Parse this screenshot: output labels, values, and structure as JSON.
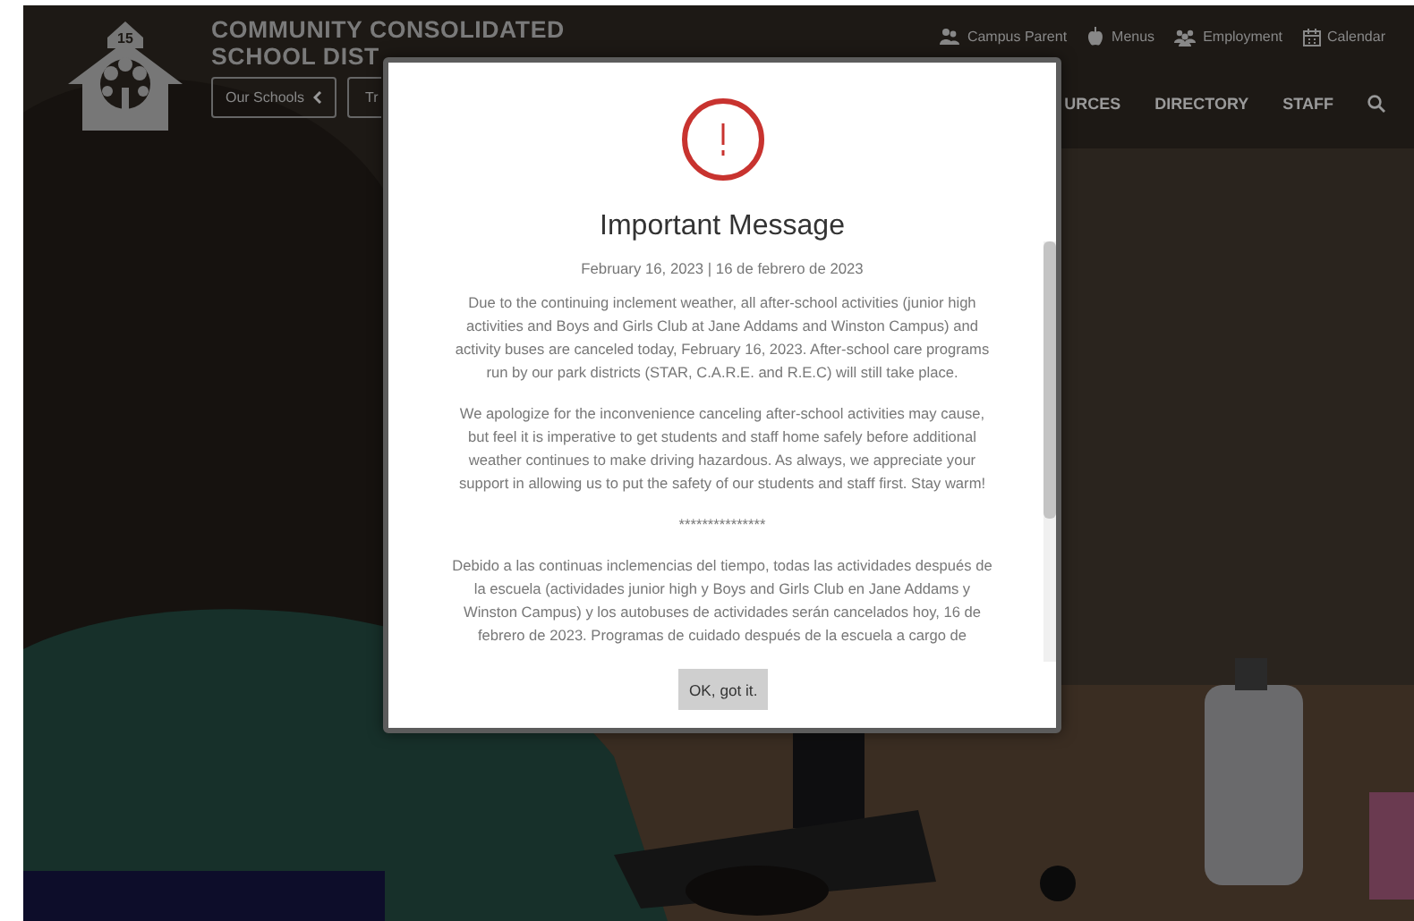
{
  "header": {
    "logo_badge": "15",
    "title_lines": [
      "COMMUNITY CONSOLIDATED",
      "SCHOOL DIST"
    ],
    "buttons": [
      {
        "label": "Our Schools",
        "kind": "dropdown"
      },
      {
        "label": "Tr",
        "kind": "plain"
      }
    ],
    "quick_links": [
      {
        "label": "Campus Parent",
        "kind": "parent"
      },
      {
        "label": "Menus",
        "kind": "menus"
      },
      {
        "label": "Employment",
        "kind": "employment"
      },
      {
        "label": "Calendar",
        "kind": "calendar"
      }
    ],
    "nav": [
      "URCES",
      "DIRECTORY",
      "STAFF"
    ]
  },
  "modal": {
    "title": "Important Message",
    "date": "February 16, 2023 | 16 de febrero de 2023",
    "paragraphs": [
      "Due to the continuing inclement weather, all after-school activities (junior high activities and Boys and Girls Club at Jane Addams and Winston Campus) and activity buses are canceled today, February 16, 2023. After-school care programs run by our park districts (STAR, C.A.R.E. and R.E.C) will still take place.",
      "We apologize for the inconvenience canceling after-school activities may cause, but feel it is imperative to get students and staff home safely before additional weather continues to make driving hazardous. As always, we appreciate your support in allowing us to put the safety of our students and staff first. Stay warm!",
      "***************",
      "Debido a las continuas inclemencias del tiempo, todas las actividades después de la escuela (actividades junior high y Boys and Girls Club en Jane Addams y Winston Campus) y los autobuses de actividades serán cancelados hoy, 16 de febrero de 2023. Programas de cuidado después de la escuela a cargo de"
    ],
    "button": "OK, got it."
  }
}
